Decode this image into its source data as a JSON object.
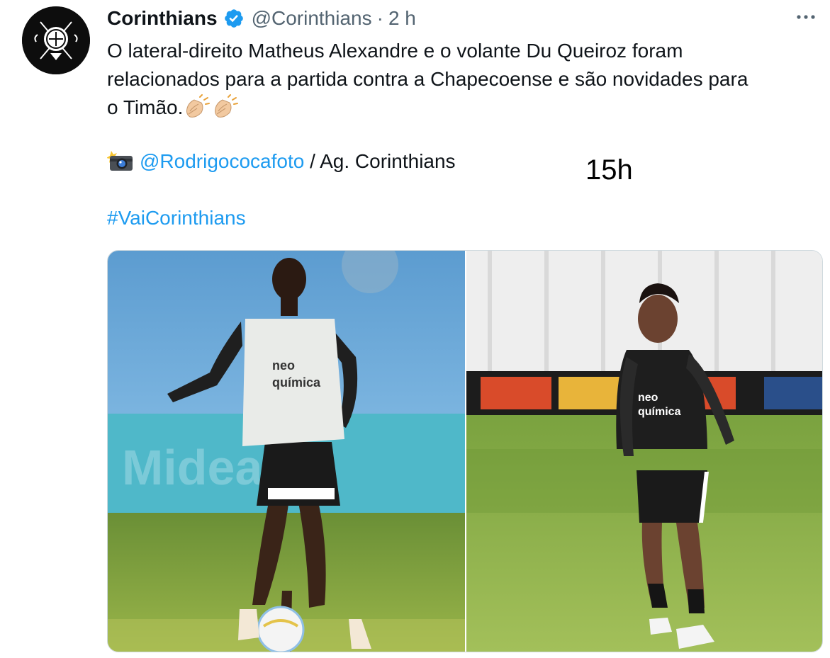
{
  "author": {
    "name": "Corinthians",
    "handle": "@Corinthians",
    "time": "2 h",
    "verified": true
  },
  "tweet": {
    "line1": "O lateral-direito Matheus Alexandre e o volante Du Queiroz foram",
    "line2": "relacionados para a partida contra a Chapecoense e são novidades para",
    "line3": "o Timão.",
    "emojis": [
      "clapping-hands-emoji",
      "clapping-hands-emoji"
    ],
    "photo_credit_handle": "@Rodrigococafoto",
    "photo_credit_rest": " / Ag. Corinthians",
    "hashtag": "#VaiCorinthians"
  },
  "overlay_text": "15h",
  "media": {
    "photos": [
      {
        "description_icon": "photo-player-bib"
      },
      {
        "description_icon": "photo-player-jersey"
      }
    ]
  },
  "colors": {
    "link": "#1d9bf0",
    "verified": "#1d9bf0",
    "secondary_text": "#536471"
  }
}
